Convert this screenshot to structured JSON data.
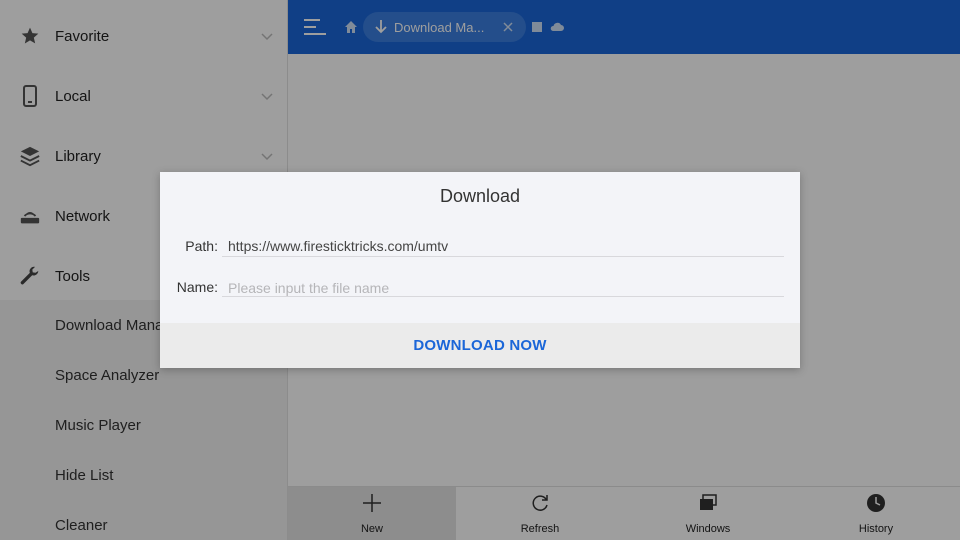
{
  "sidebar": {
    "items": [
      {
        "label": "Favorite",
        "icon": "star-icon"
      },
      {
        "label": "Local",
        "icon": "phone-icon"
      },
      {
        "label": "Library",
        "icon": "layers-icon"
      },
      {
        "label": "Network",
        "icon": "router-icon"
      },
      {
        "label": "Tools",
        "icon": "wrench-icon"
      }
    ],
    "tools": [
      "Download Manager",
      "Space Analyzer",
      "Music Player",
      "Hide List",
      "Cleaner"
    ]
  },
  "topbar": {
    "tab_label": "Download Ma...",
    "accent_color": "#1b66d8"
  },
  "bottombar": {
    "buttons": [
      {
        "label": "New",
        "icon": "plus-icon"
      },
      {
        "label": "Refresh",
        "icon": "refresh-icon"
      },
      {
        "label": "Windows",
        "icon": "windows-icon"
      },
      {
        "label": "History",
        "icon": "clock-icon"
      }
    ]
  },
  "dialog": {
    "title": "Download",
    "path_label": "Path:",
    "path_value": "https://www.firesticktricks.com/umtv",
    "name_label": "Name:",
    "name_placeholder": "Please input the file name",
    "button_label": "DOWNLOAD NOW"
  }
}
